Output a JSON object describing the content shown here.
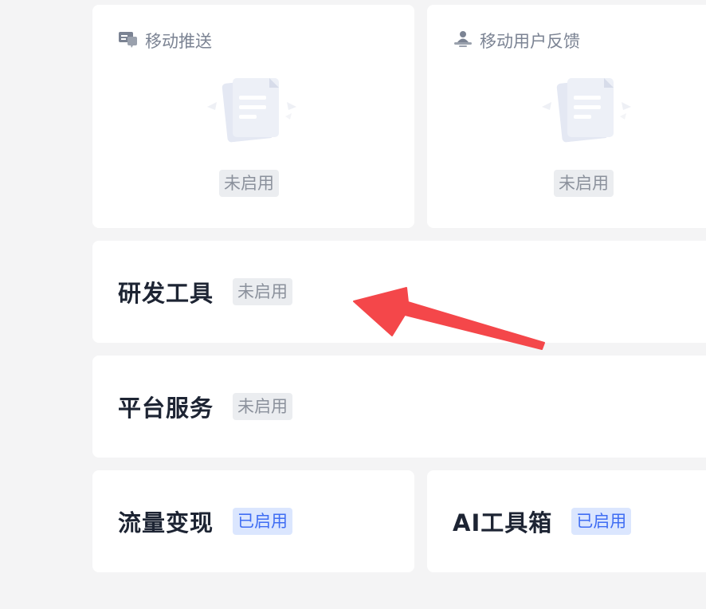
{
  "cards_top": [
    {
      "title": "移动推送",
      "icon": "push-notification-icon",
      "status": "未启用"
    },
    {
      "title": "移动用户反馈",
      "icon": "user-feedback-icon",
      "status": "未启用"
    }
  ],
  "rows": [
    {
      "title": "研发工具",
      "status": "未启用"
    },
    {
      "title": "平台服务",
      "status": "未启用"
    }
  ],
  "cards_bottom": [
    {
      "title": "流量变现",
      "status": "已启用"
    },
    {
      "title": "AI工具箱",
      "status": "已启用"
    }
  ],
  "colors": {
    "annotation_arrow": "#f4474a",
    "enabled_tag_bg": "#dbe6fe",
    "enabled_tag_text": "#3f6df3",
    "disabled_tag_bg": "#ebedf0",
    "disabled_tag_text": "#8b919c"
  }
}
